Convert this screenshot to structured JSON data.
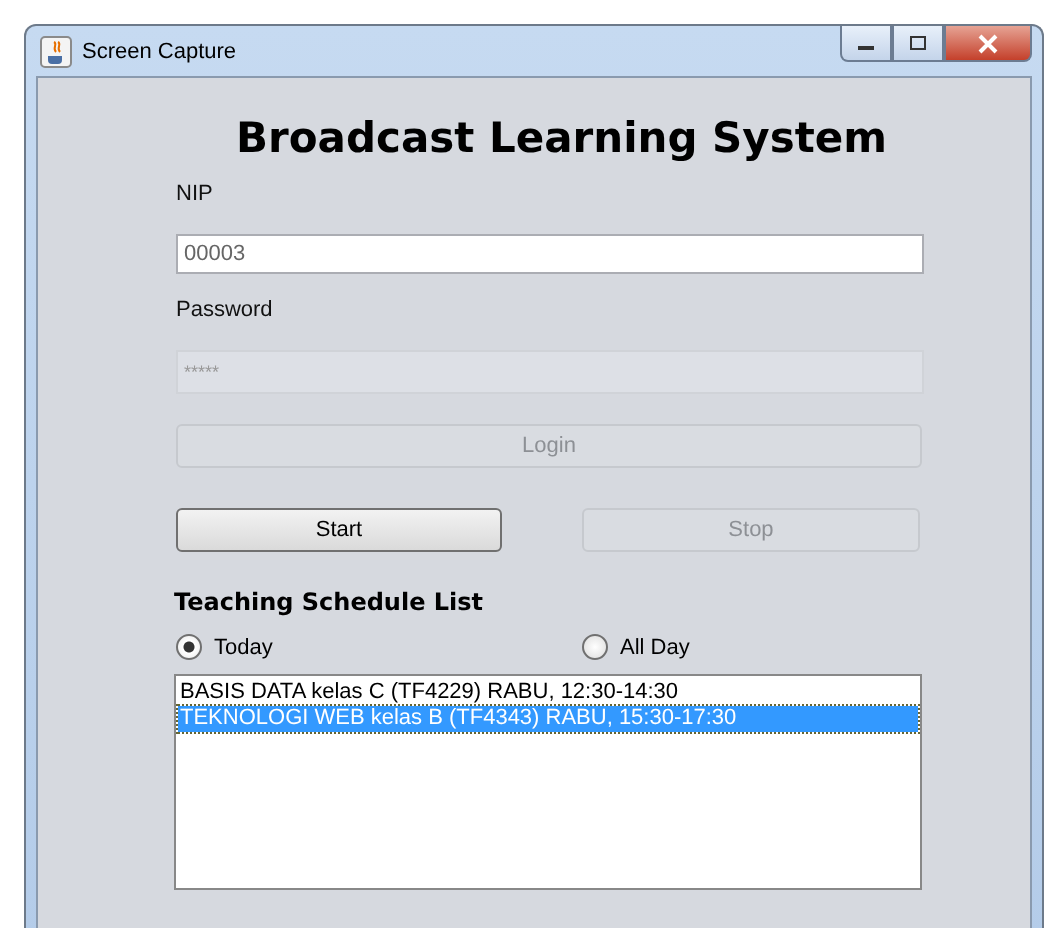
{
  "window": {
    "title": "Screen Capture"
  },
  "heading": "Broadcast Learning System",
  "nip": {
    "label": "NIP",
    "value": "00003",
    "disabled": false
  },
  "password": {
    "label": "Password",
    "value": "*****",
    "disabled": true
  },
  "buttons": [
    {
      "label": "Login",
      "disabled": true,
      "kind": "wide"
    },
    {
      "label": "Start",
      "disabled": false,
      "kind": "half"
    },
    {
      "label": "Stop",
      "disabled": true,
      "kind": "half"
    }
  ],
  "schedule": {
    "title": "Teaching Schedule List",
    "filters": [
      {
        "label": "Today",
        "selected": true
      },
      {
        "label": "All Day",
        "selected": false
      }
    ],
    "items": [
      {
        "text": "BASIS DATA kelas C (TF4229) RABU, 12:30-14:30",
        "selected": false
      },
      {
        "text": "TEKNOLOGI WEB kelas B (TF4343) RABU, 15:30-17:30",
        "selected": true
      }
    ]
  }
}
